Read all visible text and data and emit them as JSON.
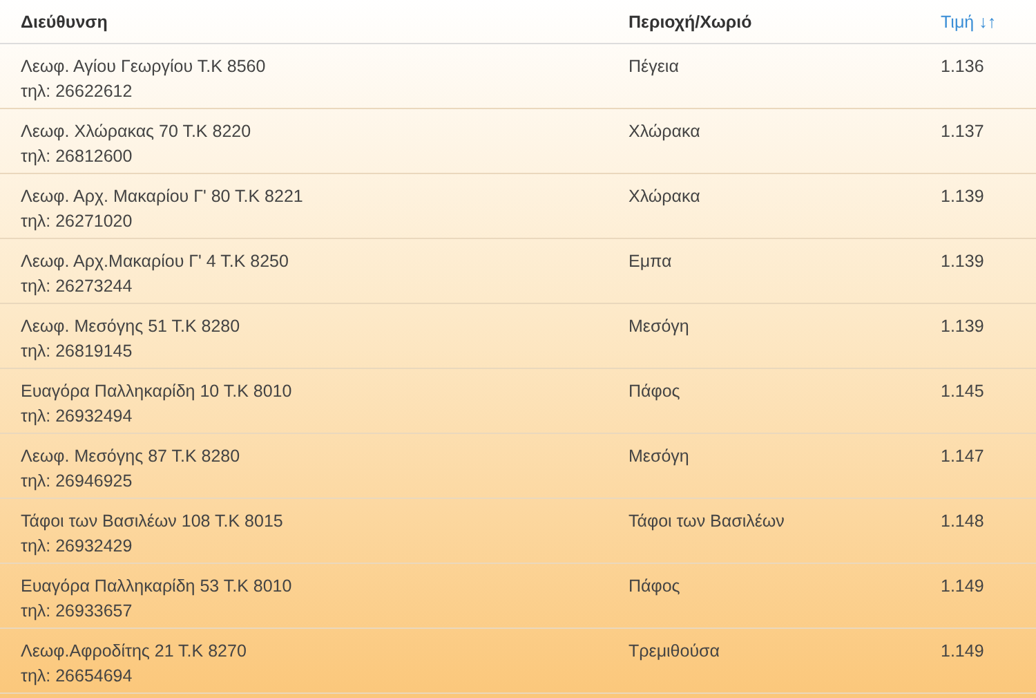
{
  "table": {
    "columns": [
      {
        "label": "Διεύθυνση",
        "selected": false
      },
      {
        "label": "Περιοχή/Χωριό",
        "selected": false
      },
      {
        "label": "Τιμή",
        "selected": true,
        "sort_glyph": "↓↑"
      }
    ],
    "rows": [
      {
        "address": "Λεωφ. Αγίου Γεωργίου Τ.Κ 8560",
        "phone": "τηλ: 26622612",
        "area": "Πέγεια",
        "price": "1.136"
      },
      {
        "address": "Λεωφ. Χλώρακας 70 Τ.Κ 8220",
        "phone": "τηλ: 26812600",
        "area": "Χλώρακα",
        "price": "1.137"
      },
      {
        "address": "Λεωφ. Αρχ. Μακαρίου Γ' 80 Τ.Κ 8221",
        "phone": "τηλ: 26271020",
        "area": "Χλώρακα",
        "price": "1.139"
      },
      {
        "address": "Λεωφ. Αρχ.Μακαρίου Γ' 4 Τ.Κ 8250",
        "phone": "τηλ: 26273244",
        "area": "Εμπα",
        "price": "1.139"
      },
      {
        "address": "Λεωφ. Μεσόγης 51 Τ.Κ 8280",
        "phone": "τηλ: 26819145",
        "area": "Μεσόγη",
        "price": "1.139"
      },
      {
        "address": "Ευαγόρα Παλληκαρίδη 10 Τ.Κ 8010",
        "phone": "τηλ: 26932494",
        "area": "Πάφος",
        "price": "1.145"
      },
      {
        "address": "Λεωφ. Μεσόγης 87 Τ.Κ 8280",
        "phone": "τηλ: 26946925",
        "area": "Μεσόγη",
        "price": "1.147"
      },
      {
        "address": "Τάφοι των Βασιλέων 108 Τ.Κ 8015",
        "phone": "τηλ: 26932429",
        "area": "Τάφοι των Βασιλέων",
        "price": "1.148"
      },
      {
        "address": "Ευαγόρα Παλληκαρίδη 53 Τ.Κ 8010",
        "phone": "τηλ: 26933657",
        "area": "Πάφος",
        "price": "1.149"
      },
      {
        "address": "Λεωφ.Αφροδίτης 21 Τ.Κ 8270",
        "phone": "τηλ: 26654694",
        "area": "Τρεμιθούσα",
        "price": "1.149"
      }
    ]
  }
}
